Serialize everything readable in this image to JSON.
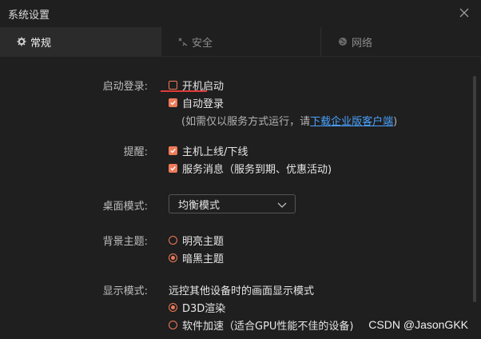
{
  "window": {
    "title": "系统设置"
  },
  "tabs": [
    {
      "label": "常规",
      "icon": "gear-icon"
    },
    {
      "label": "安全",
      "icon": "security-icon"
    },
    {
      "label": "网络",
      "icon": "globe-icon"
    }
  ],
  "startup": {
    "label": "启动登录:",
    "options": [
      {
        "label": "开机启动",
        "checked": false
      },
      {
        "label": "自动登录",
        "checked": true
      }
    ],
    "note_prefix": "(如需仅以服务方式运行，请",
    "note_link": "下载企业版客户端",
    "note_suffix": ")"
  },
  "reminder": {
    "label": "提醒:",
    "options": [
      {
        "label": "主机上线/下线",
        "checked": true
      },
      {
        "label": "服务消息（服务到期、优惠活动)",
        "checked": true
      }
    ]
  },
  "desktop": {
    "label": "桌面模式:",
    "selected": "均衡模式"
  },
  "theme": {
    "label": "背景主题:",
    "options": [
      {
        "label": "明亮主题",
        "selected": false
      },
      {
        "label": "暗黑主题",
        "selected": true
      }
    ]
  },
  "display": {
    "label": "显示模式:",
    "description": "远控其他设备时的画面显示模式",
    "options": [
      {
        "label": "D3D渲染",
        "selected": true
      },
      {
        "label": "软件加速（适合GPU性能不佳的设备)",
        "selected": false
      }
    ]
  },
  "watermark": "CSDN @JasonGKK",
  "colors": {
    "accent": "#ef7a58",
    "link": "#4aa3ff",
    "highlight": "#e03a3a"
  }
}
